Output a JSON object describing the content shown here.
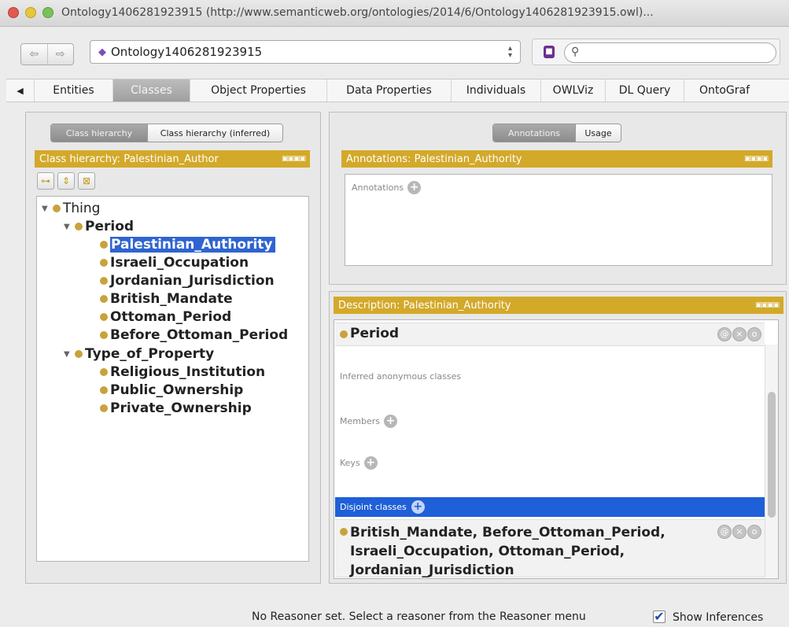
{
  "window": {
    "title": "Ontology1406281923915 (http://www.semanticweb.org/ontologies/2014/6/Ontology1406281923915.owl)..."
  },
  "toolbar": {
    "back_icon": "back-arrow-icon",
    "forward_icon": "forward-arrow-icon",
    "ontology_selector": "Ontology1406281923915",
    "search_placeholder": ""
  },
  "tabs": [
    {
      "label": "Entities"
    },
    {
      "label": "Classes",
      "active": true
    },
    {
      "label": "Object Properties"
    },
    {
      "label": "Data Properties"
    },
    {
      "label": "Individuals"
    },
    {
      "label": "OWLViz"
    },
    {
      "label": "DL Query"
    },
    {
      "label": "OntoGraf"
    }
  ],
  "left_panel": {
    "views": [
      {
        "label": "Class hierarchy",
        "active": true
      },
      {
        "label": "Class hierarchy (inferred)"
      }
    ],
    "header": "Class hierarchy: Palestinian_Author",
    "tree": [
      {
        "label": "Thing",
        "expanded": true
      },
      {
        "label": "Period",
        "expanded": true
      },
      {
        "label": "Palestinian_Authority",
        "selected": true
      },
      {
        "label": "Israeli_Occupation"
      },
      {
        "label": "Jordanian_Jurisdiction"
      },
      {
        "label": "British_Mandate"
      },
      {
        "label": "Ottoman_Period"
      },
      {
        "label": "Before_Ottoman_Period"
      },
      {
        "label": "Type_of_Property",
        "expanded": true
      },
      {
        "label": "Religious_Institution"
      },
      {
        "label": "Public_Ownership"
      },
      {
        "label": "Private_Ownership"
      }
    ]
  },
  "annotations_panel": {
    "views": [
      {
        "label": "Annotations",
        "active": true
      },
      {
        "label": "Usage"
      }
    ],
    "header": "Annotations: Palestinian_Authority",
    "annotations_label": "Annotations"
  },
  "description_panel": {
    "header": "Description: Palestinian_Authority",
    "superclass": "Period",
    "inferred_label": "Inferred anonymous classes",
    "members_label": "Members",
    "keys_label": "Keys",
    "disjoint_label": "Disjoint classes",
    "disjoint_line1": "British_Mandate, Before_Ottoman_Period,",
    "disjoint_line2": "Israeli_Occupation, Ottoman_Period,",
    "disjoint_line3": "Jordanian_Jurisdiction"
  },
  "status": {
    "message": "No Reasoner set. Select a reasoner from the Reasoner menu",
    "show_inferences_label": "Show Inferences",
    "show_inferences_checked": true
  },
  "colors": {
    "header_gold": "#d3a92a",
    "selection_blue": "#2f64d0",
    "disjoint_blue": "#1f5fd8",
    "class_dot": "#c9a23c"
  }
}
